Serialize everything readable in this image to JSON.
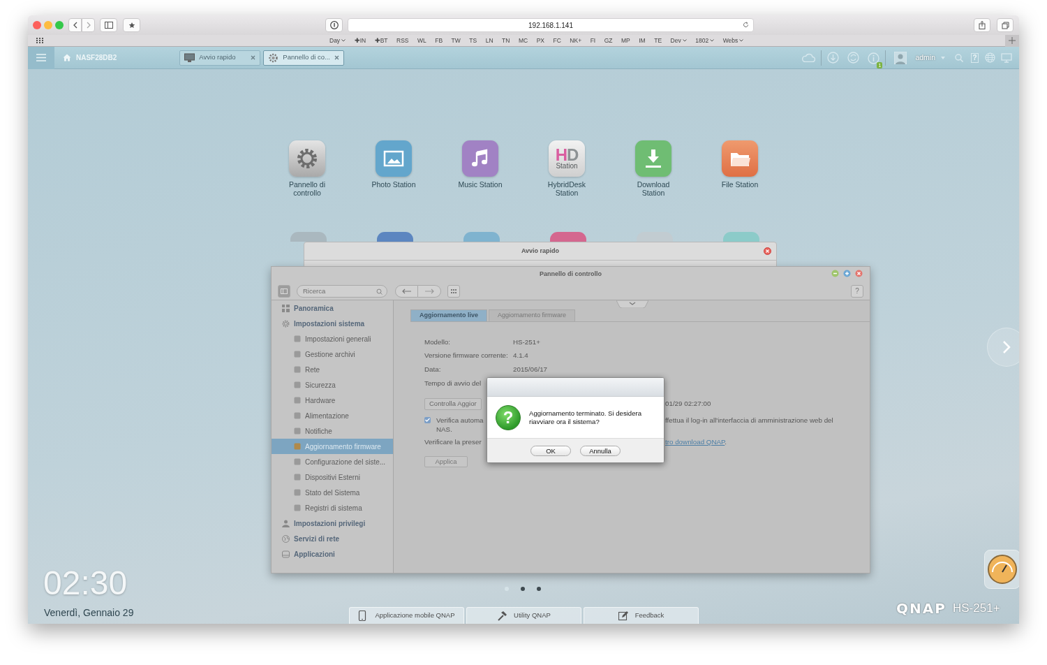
{
  "browser": {
    "address": "192.168.1.141",
    "bookmarks": [
      {
        "label": "Day",
        "menu": true
      },
      {
        "label": "✚IN",
        "menu": false
      },
      {
        "label": "✚BT",
        "menu": false
      },
      {
        "label": "RSS",
        "menu": false
      },
      {
        "label": "WL",
        "menu": false
      },
      {
        "label": "FB",
        "menu": false
      },
      {
        "label": "TW",
        "menu": false
      },
      {
        "label": "TS",
        "menu": false
      },
      {
        "label": "LN",
        "menu": false
      },
      {
        "label": "TN",
        "menu": false
      },
      {
        "label": "MC",
        "menu": false
      },
      {
        "label": "PX",
        "menu": false
      },
      {
        "label": "FC",
        "menu": false
      },
      {
        "label": "NK+",
        "menu": false
      },
      {
        "label": "FI",
        "menu": false
      },
      {
        "label": "GZ",
        "menu": false
      },
      {
        "label": "MP",
        "menu": false
      },
      {
        "label": "IM",
        "menu": false
      },
      {
        "label": "TE",
        "menu": false
      },
      {
        "label": "Dev",
        "menu": true
      },
      {
        "label": "1802",
        "menu": true
      },
      {
        "label": "Webs",
        "menu": true
      }
    ]
  },
  "top_bar": {
    "host": "NASF28DB2",
    "tabs": [
      {
        "label": "Avvio rapido",
        "selected": false
      },
      {
        "label": "Pannello di co...",
        "selected": true
      }
    ],
    "notification_count": "1",
    "user": "admin",
    "help": "?"
  },
  "desktop": {
    "apps": [
      {
        "label": "Pannello di controllo",
        "kind": "gear"
      },
      {
        "label": "Photo Station",
        "kind": "photo"
      },
      {
        "label": "Music Station",
        "kind": "music"
      },
      {
        "label": "HybridDesk Station",
        "kind": "lettered",
        "icon_letters": "HD",
        "icon_caption": "Station"
      },
      {
        "label": "Download Station",
        "kind": "download"
      },
      {
        "label": "File Station",
        "kind": "folder"
      }
    ],
    "quick_start_window": {
      "title": "Avvio rapido"
    },
    "clock": "02:30",
    "date": "Venerdì, Gennaio 29",
    "pages": [
      {
        "selected": true
      },
      {
        "selected": false
      },
      {
        "selected": false
      }
    ],
    "links": [
      {
        "label": "Applicazione mobile QNAP"
      },
      {
        "label": "Utility QNAP"
      },
      {
        "label": "Feedback"
      }
    ],
    "brand": "QNAP",
    "model": "HS-251+"
  },
  "panel": {
    "title": "Pannello di controllo",
    "search_placeholder": "Ricerca",
    "help": "?",
    "sidebar": {
      "items": [
        {
          "label": "Panoramica",
          "selected": false
        },
        {
          "label": "Impostazioni sistema",
          "selected": false,
          "children": [
            {
              "label": "Impostazioni generali",
              "selected": false
            },
            {
              "label": "Gestione archivi",
              "selected": false
            },
            {
              "label": "Rete",
              "selected": false
            },
            {
              "label": "Sicurezza",
              "selected": false
            },
            {
              "label": "Hardware",
              "selected": false
            },
            {
              "label": "Alimentazione",
              "selected": false
            },
            {
              "label": "Notifiche",
              "selected": false
            },
            {
              "label": "Aggiornamento firmware",
              "selected": true
            },
            {
              "label": "Configurazione del siste...",
              "selected": false
            },
            {
              "label": "Dispositivi Esterni",
              "selected": false
            },
            {
              "label": "Stato del Sistema",
              "selected": false
            },
            {
              "label": "Registri di sistema",
              "selected": false
            }
          ]
        },
        {
          "label": "Impostazioni privilegi",
          "selected": false
        },
        {
          "label": "Servizi di rete",
          "selected": false
        },
        {
          "label": "Applicazioni",
          "selected": false
        }
      ]
    },
    "tabs": [
      {
        "label": "Aggiornamento live",
        "selected": true
      },
      {
        "label": "Aggiornamento firmware",
        "selected": false
      }
    ],
    "fields": [
      {
        "label": "Modello:",
        "value": "HS-251+"
      },
      {
        "label": "Versione firmware corrente:",
        "value": "4.1.4"
      },
      {
        "label": "Data:",
        "value": "2015/06/17"
      }
    ],
    "boot_label": "Tempo di avvio del",
    "check_button": "Controlla Aggior",
    "check_time": "01/29 02:27:00",
    "auto_check": {
      "checked": true,
      "text_left": "Verifica automa",
      "text_wrap": "NAS.",
      "text_right": "ffettua il log-in all'interfaccia di amministrazione web del"
    },
    "download_note": {
      "text_left": "Verificare la preser",
      "link": "tro download QNAP",
      "text_end": "."
    },
    "apply_button": "Applica"
  },
  "dialog": {
    "icon_glyph": "?",
    "message": "Aggiornamento terminato. Si desidera riavviare ora il sistema?",
    "buttons": [
      "OK",
      "Annulla"
    ]
  }
}
